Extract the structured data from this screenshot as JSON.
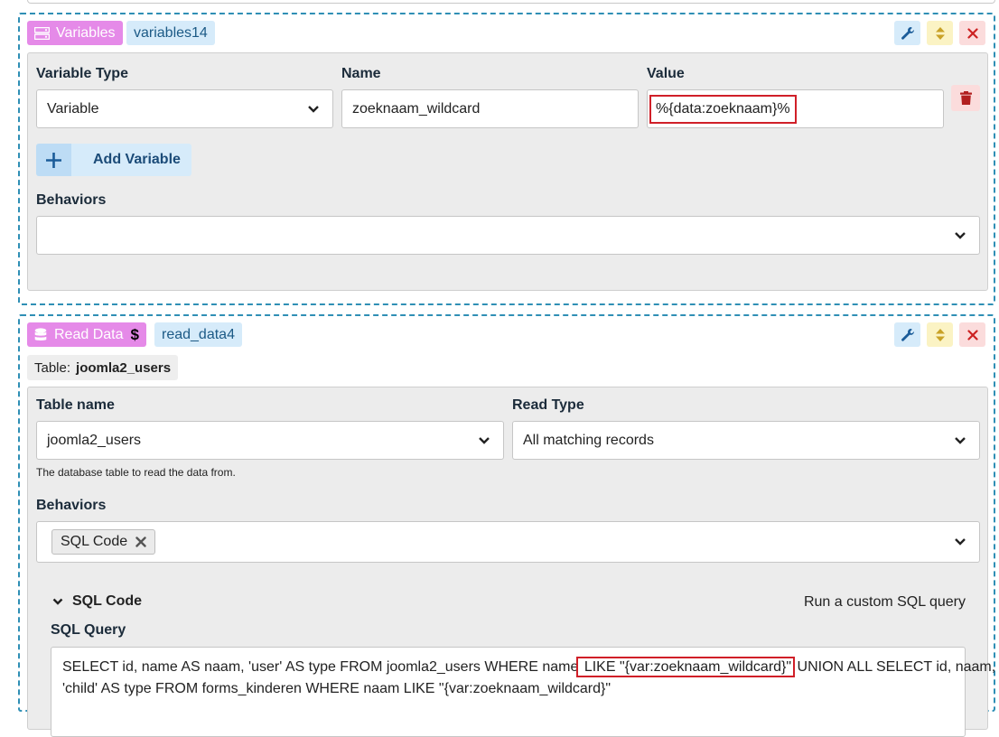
{
  "variables_block": {
    "type_label": "Variables",
    "id_label": "variables14",
    "columns": {
      "type": "Variable Type",
      "name": "Name",
      "value": "Value"
    },
    "row": {
      "type": "Variable",
      "name": "zoeknaam_wildcard",
      "value": "%{data:zoeknaam}%"
    },
    "add_label": "Add Variable",
    "behaviors_label": "Behaviors",
    "behaviors_value": ""
  },
  "read_block": {
    "type_label": "Read Data",
    "type_suffix": "$",
    "id_label": "read_data4",
    "table_tag_prefix": "Table:",
    "table_tag_value": "joomla2_users",
    "table_name_label": "Table name",
    "table_name_value": "joomla2_users",
    "table_name_hint": "The database table to read the data from.",
    "read_type_label": "Read Type",
    "read_type_value": "All matching records",
    "behaviors_label": "Behaviors",
    "behavior_chip": "SQL Code",
    "sql_section_title": "SQL Code",
    "sql_section_desc": "Run a custom SQL query",
    "sql_query_label": "SQL Query",
    "sql_line1_pre": "SELECT id, name AS naam, 'user' AS type FROM joomla2_users WHERE name",
    "sql_line1_hl": " LIKE \"{var:zoeknaam_wildcard}\"",
    "sql_line1_post": " UNION ALL SELECT id, naam,",
    "sql_line2": "'child' AS type FROM forms_kinderen WHERE naam LIKE \"{var:zoeknaam_wildcard}\""
  },
  "colors": {
    "dashed_border": "#2f8fb5",
    "type_tag": "#e58ae8",
    "highlight": "#d01f28"
  }
}
